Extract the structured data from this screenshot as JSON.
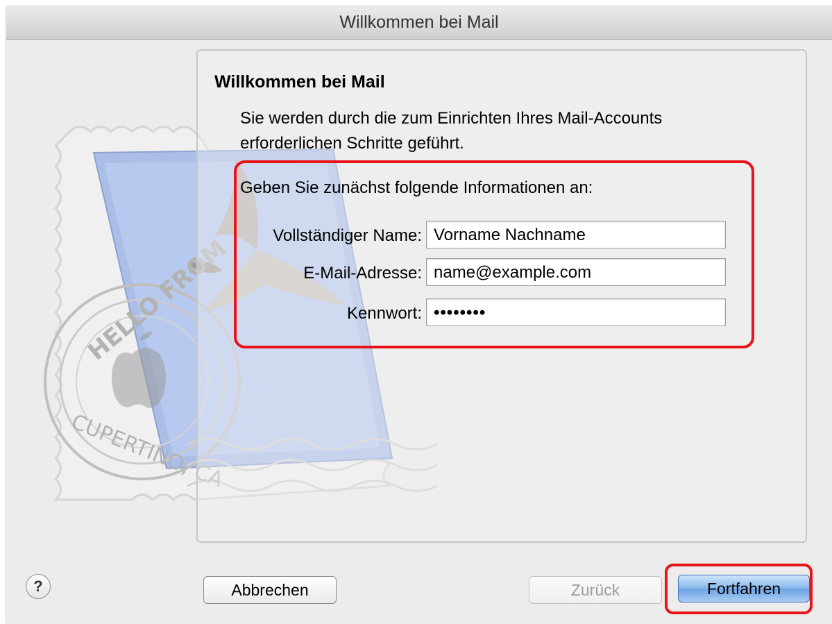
{
  "window": {
    "title": "Willkommen bei Mail"
  },
  "content": {
    "heading": "Willkommen bei Mail",
    "intro": "Sie werden durch die zum Einrichten Ihres Mail-Accounts erforderlichen Schritte geführt.",
    "prompt": "Geben Sie zunächst folgende Informationen an:"
  },
  "form": {
    "full_name": {
      "label": "Vollständiger Name:",
      "value": "Vorname Nachname"
    },
    "email": {
      "label": "E-Mail-Adresse:",
      "value": "name@example.com"
    },
    "password": {
      "label": "Kennwort:",
      "value": "••••••••"
    }
  },
  "stamp": {
    "text_top": "HELLO FROM",
    "text_bottom": "CUPERTINO, CA"
  },
  "buttons": {
    "help": "?",
    "cancel": "Abbrechen",
    "back": "Zurück",
    "continue": "Fortfahren"
  },
  "colors": {
    "highlight": "#e8141a",
    "primary_button": "#86b7ec"
  },
  "icons": [
    "mail-stamp-icon",
    "help-icon"
  ]
}
